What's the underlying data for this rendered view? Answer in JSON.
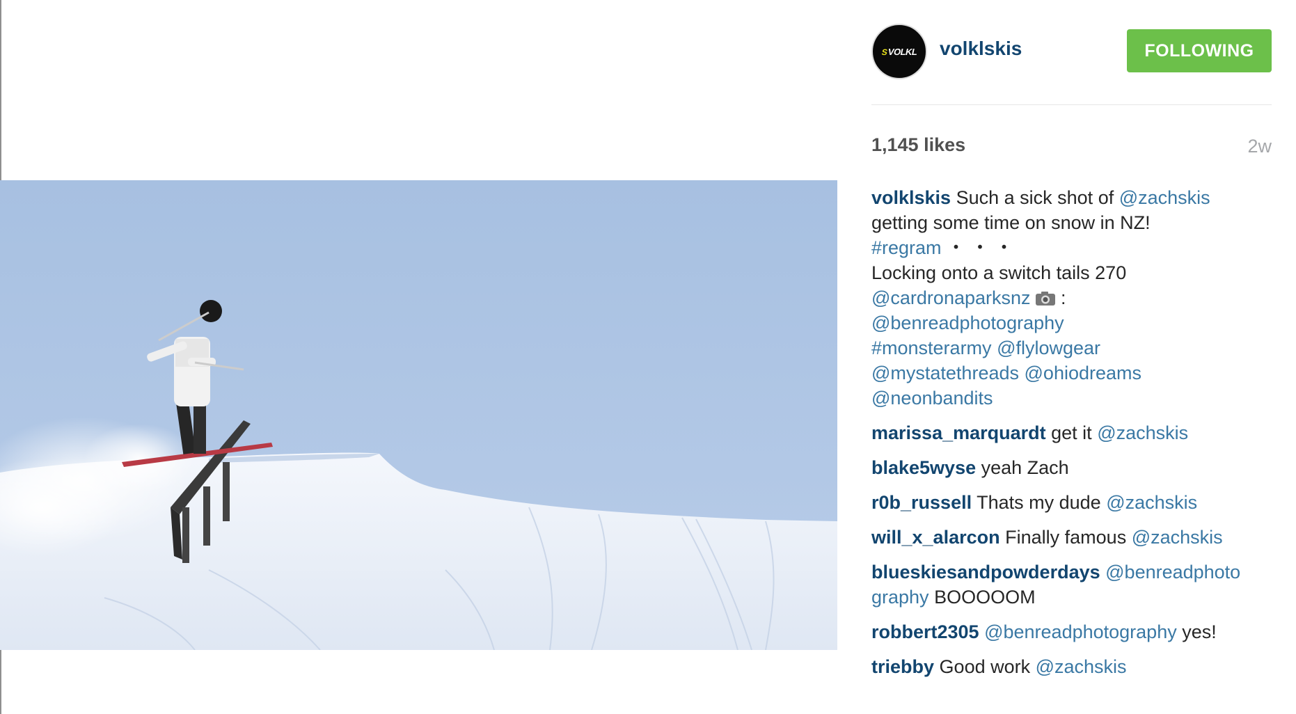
{
  "post": {
    "username": "volklskis",
    "follow_label": "FOLLOWING",
    "avatar_logo": {
      "mark": "S",
      "text": "VOLKL"
    },
    "likes": "1,145 likes",
    "time": "2w",
    "caption": {
      "author": "volklskis",
      "segments": [
        {
          "text": "Such a sick shot of ",
          "link": false
        },
        {
          "text": "@zachskis",
          "link": true
        },
        {
          "text": "\ngetting some time on snow in NZ!\n",
          "link": false
        },
        {
          "text": "#regram",
          "link": true
        },
        {
          "text": " ・ ・ ・\nLocking onto a switch tails 270\n",
          "link": false
        },
        {
          "text": "@cardronaparksnz",
          "link": true
        },
        {
          "text": " ",
          "link": false,
          "icon": "camera-icon"
        },
        {
          "text": ":\n",
          "link": false
        },
        {
          "text": "@benreadphotography",
          "link": true
        },
        {
          "text": "\n",
          "link": false
        },
        {
          "text": "#monsterarmy",
          "link": true
        },
        {
          "text": " ",
          "link": false
        },
        {
          "text": "@flylowgear",
          "link": true
        },
        {
          "text": "\n",
          "link": false
        },
        {
          "text": "@mystatethreads",
          "link": true
        },
        {
          "text": " ",
          "link": false
        },
        {
          "text": "@ohiodreams",
          "link": true
        },
        {
          "text": "\n",
          "link": false
        },
        {
          "text": "@neonbandits",
          "link": true
        }
      ]
    },
    "comments": [
      {
        "author": "marissa_marquardt",
        "segments": [
          {
            "text": "get it ",
            "link": false
          },
          {
            "text": "@zachskis",
            "link": true
          }
        ]
      },
      {
        "author": "blake5wyse",
        "segments": [
          {
            "text": "yeah Zach",
            "link": false
          }
        ]
      },
      {
        "author": "r0b_russell",
        "segments": [
          {
            "text": "Thats my dude ",
            "link": false
          },
          {
            "text": "@zachskis",
            "link": true
          }
        ]
      },
      {
        "author": "will_x_alarcon",
        "segments": [
          {
            "text": "Finally famous ",
            "link": false
          },
          {
            "text": "@zachskis",
            "link": true
          }
        ]
      },
      {
        "author": "blueskiesandpowderdays",
        "segments": [
          {
            "text": "@benreadphoto\ngraphy",
            "link": true
          },
          {
            "text": " BOOOOOM",
            "link": false
          }
        ]
      },
      {
        "author": "robbert2305",
        "segments": [
          {
            "text": "@benreadphotography",
            "link": true
          },
          {
            "text": " yes!",
            "link": false
          }
        ]
      },
      {
        "author": "triebby",
        "segments": [
          {
            "text": "Good work ",
            "link": false
          },
          {
            "text": "@zachskis",
            "link": true
          }
        ]
      }
    ]
  },
  "colors": {
    "author": "#12456f",
    "link": "#3a78a4",
    "follow_button": "#6cc04a",
    "sky": "#a9c2e2"
  }
}
